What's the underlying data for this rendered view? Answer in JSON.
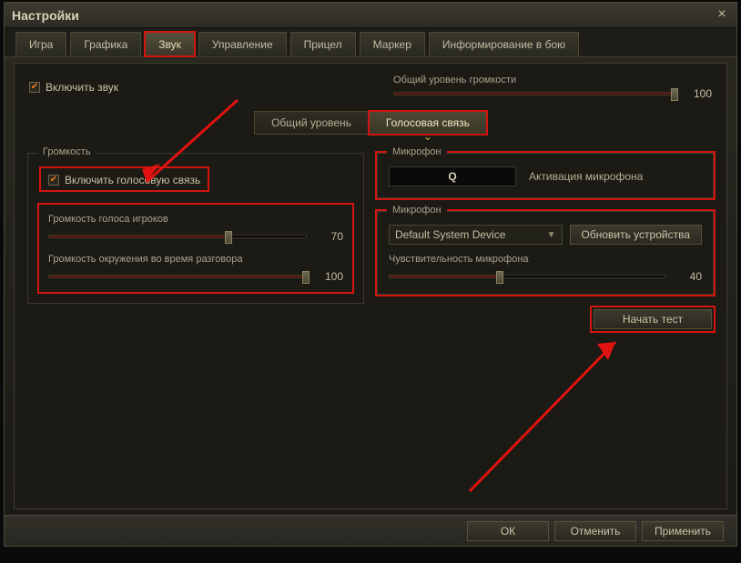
{
  "window": {
    "title": "Настройки"
  },
  "tabs": [
    {
      "label": "Игра"
    },
    {
      "label": "Графика"
    },
    {
      "label": "Звук",
      "active": true,
      "highlighted": true
    },
    {
      "label": "Управление"
    },
    {
      "label": "Прицел"
    },
    {
      "label": "Маркер"
    },
    {
      "label": "Информирование в бою"
    }
  ],
  "enable_sound_label": "Включить звук",
  "master_volume": {
    "label": "Общий уровень громкости",
    "value": 100
  },
  "subtabs": [
    {
      "label": "Общий уровень"
    },
    {
      "label": "Голосовая связь",
      "active": true,
      "highlighted": true
    }
  ],
  "left": {
    "fieldset_title": "Громкость",
    "enable_voice_label": "Включить голосовую связь",
    "slider1": {
      "label": "Громкость голоса игроков",
      "value": 70
    },
    "slider2": {
      "label": "Громкость окружения во время разговора",
      "value": 100
    }
  },
  "right": {
    "mic_section_title": "Микрофон",
    "key": "Q",
    "key_label": "Активация микрофона",
    "mic_device_section_title": "Микрофон",
    "device_selected": "Default System Device",
    "refresh_btn": "Обновить устройства",
    "sensitivity": {
      "label": "Чувствительность микрофона",
      "value": 40
    },
    "start_test": "Начать тест"
  },
  "footer": {
    "ok": "ОК",
    "cancel": "Отменить",
    "apply": "Применить"
  }
}
